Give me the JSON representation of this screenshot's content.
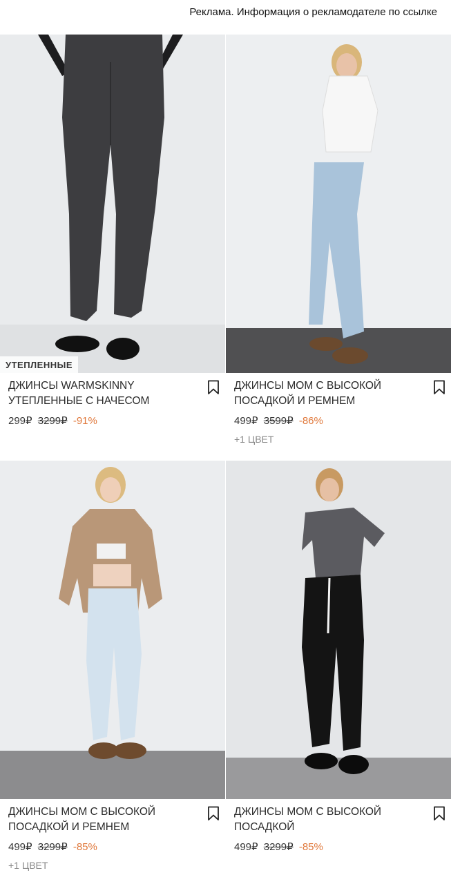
{
  "ad_notice": "Реклама. Информация о рекламодателе по ссылке",
  "products": [
    {
      "tag": "УТЕПЛЕННЫЕ",
      "title": "ДЖИНСЫ WARMSKINNY УТЕПЛЕННЫЕ С НАЧЕСОМ",
      "price": "299₽",
      "old_price": "3299₽",
      "discount": "-91%",
      "colors": ""
    },
    {
      "tag": "",
      "title": "ДЖИНСЫ MOM С ВЫСОКОЙ ПОСАДКОЙ И РЕМНЕМ",
      "price": "499₽",
      "old_price": "3599₽",
      "discount": "-86%",
      "colors": "+1 ЦВЕТ"
    },
    {
      "tag": "",
      "title": "ДЖИНСЫ MOM С ВЫСОКОЙ ПОСАДКОЙ И РЕМНЕМ",
      "price": "499₽",
      "old_price": "3299₽",
      "discount": "-85%",
      "colors": "+1 ЦВЕТ"
    },
    {
      "tag": "",
      "title": "ДЖИНСЫ MOM С ВЫСОКОЙ ПОСАДКОЙ",
      "price": "499₽",
      "old_price": "3299₽",
      "discount": "-85%",
      "colors": ""
    }
  ],
  "icons": {
    "bookmark": "bookmark-icon"
  },
  "colors": {
    "discount": "#e0783b",
    "text": "#2a2a2a",
    "muted": "#8a8a8a"
  }
}
